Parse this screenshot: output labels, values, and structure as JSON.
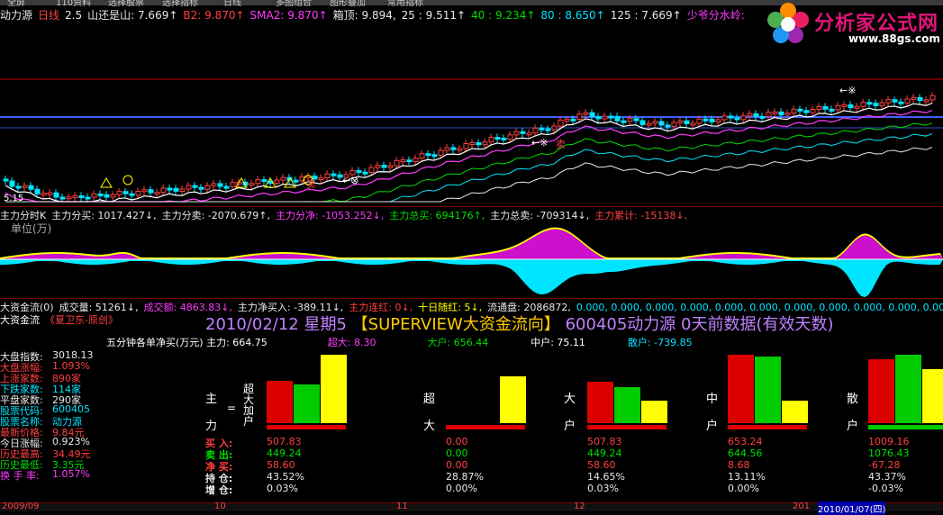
{
  "menu": [
    "全屏",
    "110资料",
    "选择股票",
    "选择指标",
    "日线",
    "多图组合",
    "图形叠加",
    "常用指标"
  ],
  "kline_header": [
    {
      "t": "动力源",
      "c": "white"
    },
    {
      "t": "日线",
      "c": "red"
    },
    {
      "t": "2.5",
      "c": "white"
    },
    {
      "t": "山还是山: 7.669↑",
      "c": "white"
    },
    {
      "t": "B2: 9.870↑",
      "c": "red"
    },
    {
      "t": "SMA2: 9.870↑",
      "c": "mag"
    },
    {
      "t": "箱顶: 9.894,",
      "c": "white"
    },
    {
      "t": "25 : 9.511↑",
      "c": "white"
    },
    {
      "t": "40 : 9.234↑",
      "c": "green"
    },
    {
      "t": "80 : 8.650↑",
      "c": "cyan"
    },
    {
      "t": "125 : 7.669↑",
      "c": "white"
    },
    {
      "t": "少爷分水岭:",
      "c": "mag"
    }
  ],
  "kline_low_label": "5.15",
  "kline_annot": {
    "sell": "卖",
    "arrow": "←⊗",
    "hit": "←※"
  },
  "logo": {
    "name": "分析家公式网",
    "url": "www.88gs.com"
  },
  "flow_header": [
    {
      "t": "主力分时K",
      "c": "white"
    },
    {
      "t": "主力分买: 1017.427↓,",
      "c": "white"
    },
    {
      "t": "主力分卖: -2070.679↑,",
      "c": "white"
    },
    {
      "t": "主力分净: -1053.252↓,",
      "c": "mag"
    },
    {
      "t": "主力总买: 694176↑,",
      "c": "green"
    },
    {
      "t": "主力总卖: -709314↓,",
      "c": "white"
    },
    {
      "t": "主力累计: -15138↓,",
      "c": "red"
    }
  ],
  "flow_unit": "单位(万)",
  "vol_header": [
    {
      "t": "大资金流(0)",
      "c": "white"
    },
    {
      "t": "成交量: 51261↓,",
      "c": "white"
    },
    {
      "t": "成交额: 4863.83↓,",
      "c": "mag"
    },
    {
      "t": "主力净买入: -389.11↓,",
      "c": "white"
    },
    {
      "t": "主力连红: 0↓,",
      "c": "red"
    },
    {
      "t": "十日随红: 5↓,",
      "c": "yellow"
    },
    {
      "t": "流通盘: 2086872,",
      "c": "white"
    },
    {
      "t": "0.000, 0.000, 0.000, 0.000, 0.000, 0.000, 0.000, 0.000, 0.000, 0.000, 0.00",
      "c": "cyan"
    }
  ],
  "panel": {
    "name": "大资金流",
    "author": "《夏卫东-原创》",
    "date": "2010/02/12",
    "weekday": "星期5",
    "title": "【SUPERVIEW大资金流向】",
    "stock": "600405动力源",
    "days": "0天前数据(有效天数)",
    "five_min_label": "五分钟各单净买(万元)",
    "main_net": "主力: 664.75",
    "super_net": "超大: 8.30",
    "big_net": "大户: 656.44",
    "mid_net": "中户: 75.11",
    "small_net": "散户: -739.85"
  },
  "stats": [
    {
      "k": "大盘指数:",
      "v": "3018.13",
      "kc": "white",
      "vc": "white"
    },
    {
      "k": "大盘涨幅:",
      "v": "1.093%",
      "kc": "red",
      "vc": "red"
    },
    {
      "k": "上涨家数:",
      "v": "890家",
      "kc": "red",
      "vc": "red"
    },
    {
      "k": "下跌家数:",
      "v": "114家",
      "kc": "cyan",
      "vc": "cyan"
    },
    {
      "k": "平盘家数:",
      "v": "290家",
      "kc": "white",
      "vc": "white"
    },
    {
      "k": "股票代码:",
      "v": "600405",
      "kc": "cyan",
      "vc": "cyan"
    },
    {
      "k": "股票名称:",
      "v": "动力源",
      "kc": "cyan",
      "vc": "cyan"
    },
    {
      "k": "最新价格:",
      "v": "9.84元",
      "kc": "red",
      "vc": "red"
    },
    {
      "k": "今日涨幅:",
      "v": "0.923%",
      "kc": "white",
      "vc": "white"
    },
    {
      "k": "历史最高:",
      "v": "34.49元",
      "kc": "red",
      "vc": "red"
    },
    {
      "k": "历史最低:",
      "v": "3.35元",
      "kc": "green",
      "vc": "green"
    },
    {
      "k": "换 手 率:",
      "v": "1.057%",
      "kc": "mag",
      "vc": "mag"
    }
  ],
  "groups": [
    {
      "label": [
        "主",
        "力"
      ],
      "eq": "=",
      "sub": "超大加户",
      "bars": [
        0.62,
        0.56,
        1.0
      ],
      "vals": [
        "507.83",
        "449.24",
        "58.60",
        "43.52%",
        "0.03%"
      ]
    },
    {
      "label": [
        "超",
        "大"
      ],
      "bars": [
        0,
        0,
        0.68
      ],
      "vals": [
        "0.00",
        "0.00",
        "0.00",
        "28.87%",
        "0.00%"
      ]
    },
    {
      "label": [
        "大",
        "户"
      ],
      "bars": [
        0.6,
        0.53,
        0.33
      ],
      "vals": [
        "507.83",
        "449.24",
        "58.60",
        "14.65%",
        "0.03%"
      ]
    },
    {
      "label": [
        "中",
        "户"
      ],
      "bars": [
        1.0,
        0.97,
        0.33
      ],
      "vals": [
        "653.24",
        "644.56",
        "8.68",
        "13.11%",
        "0.00%"
      ]
    },
    {
      "label": [
        "散",
        "户"
      ],
      "bars": [
        0.93,
        1.0,
        0.79
      ],
      "vals": [
        "1009.16",
        "1076.43",
        "-67.28",
        "43.37%",
        "-0.03%"
      ]
    }
  ],
  "row_labels": [
    "买 入:",
    "卖 出:",
    "净 买:",
    "持 仓:",
    "增 仓:"
  ],
  "axis": {
    "d1": "2009/09",
    "d2": "10",
    "d3": "11",
    "d4": "12",
    "d5": "201",
    "d6": "2010/01/07(四)"
  }
}
